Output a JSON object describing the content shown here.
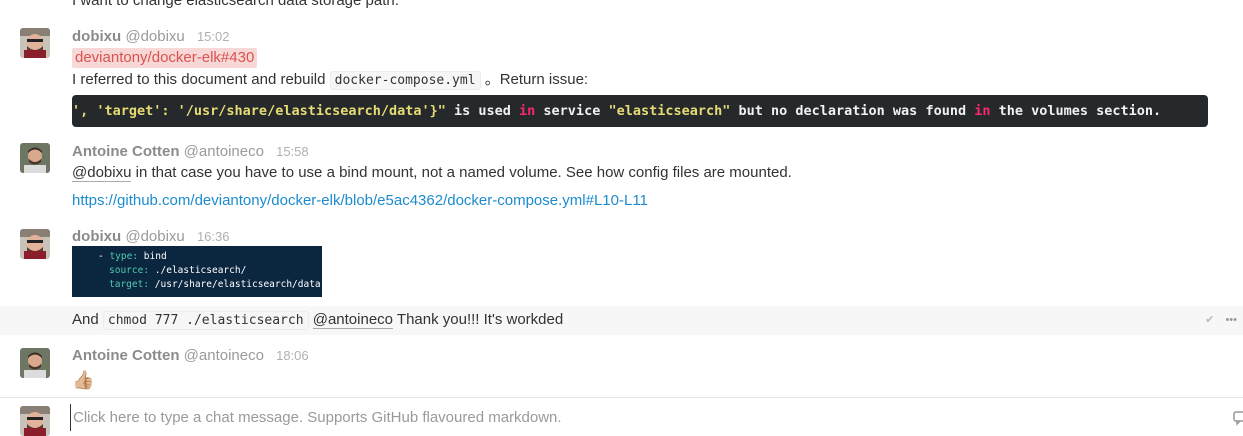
{
  "previous_message": {
    "text": "I want to change elasticsearch data storage path."
  },
  "messages": [
    {
      "user": "dobixu",
      "handle": "@dobixu",
      "time": "15:02",
      "issue_ref": "deviantony/docker-elk#430",
      "text_before_code": "I referred to this document and rebuild",
      "inline_code": "docker-compose.yml",
      "text_after_code": "。Return issue:",
      "code_block": {
        "part1": "', 'target': '/usr/share/elasticsearch/data'}\"",
        "part2": " is used ",
        "kw1": "in",
        "part3": " service ",
        "part4": "\"elasticsearch\"",
        "part5": " but no declaration was found ",
        "kw2": "in",
        "part6": " the volumes section."
      }
    },
    {
      "user": "Antoine Cotten",
      "handle": "@antoineco",
      "time": "15:58",
      "mention": "@dobixu",
      "text": "in that case you have to use a bind mount, not a named volume. See how config files are mounted.",
      "link": "https://github.com/deviantony/docker-elk/blob/e5ac4362/docker-compose.yml#L10-L11"
    },
    {
      "user": "dobixu",
      "handle": "@dobixu",
      "time": "16:36",
      "yaml": {
        "dash": "- ",
        "type_key": "type:",
        "type_val": "bind",
        "source_key": "source:",
        "source_val": "./elasticsearch/",
        "target_key": "target:",
        "target_val": "/usr/share/elasticsearch/data"
      },
      "follow_up": {
        "lead": "And",
        "code": "chmod 777 ./elasticsearch",
        "mention": "@antoineco",
        "text": "Thank you!!! It's workded"
      }
    },
    {
      "user": "Antoine Cotten",
      "handle": "@antoineco",
      "time": "18:06",
      "emoji": "👍🏼"
    }
  ],
  "composer": {
    "placeholder": "Click here to type a chat message. Supports GitHub flavoured markdown."
  },
  "icons": {
    "read": "check-icon",
    "more": "more-icon"
  },
  "colors": {
    "link": "#1c8ccf",
    "issue_bg": "#f8d7d7",
    "issue_text": "#d9534f",
    "code_bg": "#26292b"
  }
}
